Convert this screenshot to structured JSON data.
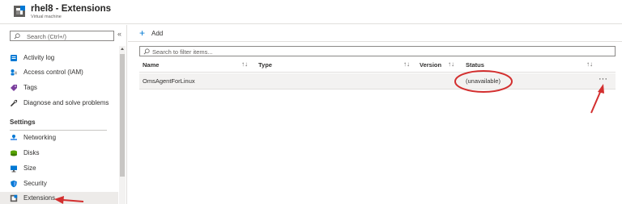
{
  "header": {
    "title": "rhel8 - Extensions",
    "subtitle": "Virtual machine",
    "icon": "extension-resource-icon"
  },
  "sidebar": {
    "search_placeholder": "Search (Ctrl+/)",
    "collapse": "«",
    "items": [
      {
        "label": "Activity log",
        "icon": "activity-log-icon"
      },
      {
        "label": "Access control (IAM)",
        "icon": "access-control-icon"
      },
      {
        "label": "Tags",
        "icon": "tag-icon"
      },
      {
        "label": "Diagnose and solve problems",
        "icon": "wrench-icon"
      }
    ],
    "section_title": "Settings",
    "settings_items": [
      {
        "label": "Networking",
        "icon": "networking-icon"
      },
      {
        "label": "Disks",
        "icon": "disks-icon"
      },
      {
        "label": "Size",
        "icon": "monitor-icon"
      },
      {
        "label": "Security",
        "icon": "shield-icon"
      },
      {
        "label": "Extensions",
        "icon": "extensions-icon",
        "active": true
      }
    ]
  },
  "toolbar": {
    "add_icon": "+",
    "add_label": "Add"
  },
  "filter": {
    "placeholder": "Search to filter items..."
  },
  "table": {
    "sort_glyph": "↑↓",
    "columns": [
      "Name",
      "Type",
      "Version",
      "Status"
    ],
    "rows": [
      {
        "name": "OmsAgentForLinux",
        "type": "",
        "version": "",
        "status": "(unavailable)",
        "more": "···"
      }
    ]
  },
  "colors": {
    "accent": "#0078d4",
    "annotation": "#d32f2f",
    "selected_row": "#f3f2f1"
  }
}
